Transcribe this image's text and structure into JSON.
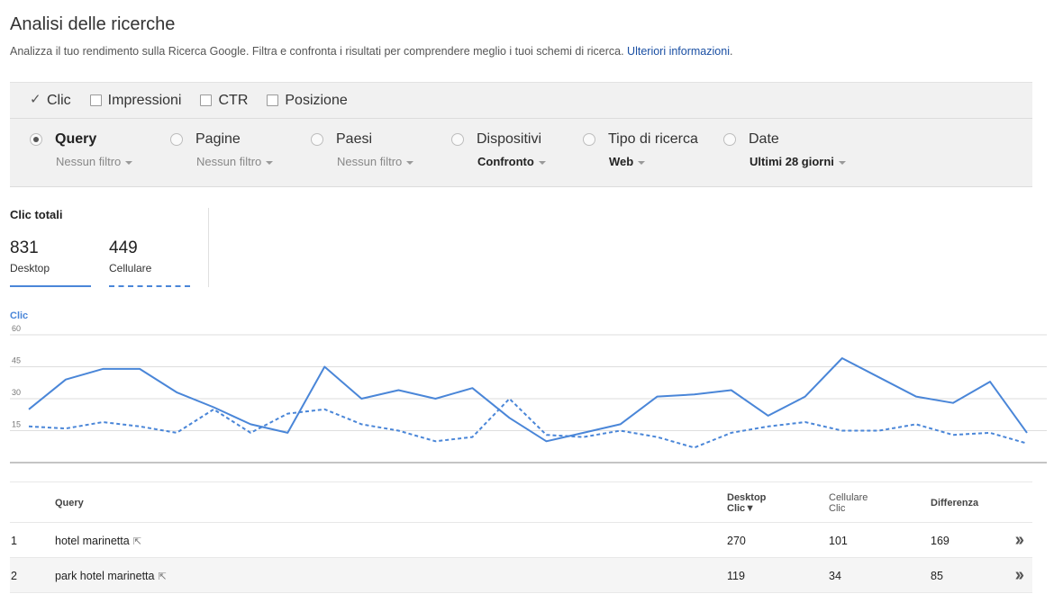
{
  "header": {
    "title": "Analisi delle ricerche",
    "description": "Analizza il tuo rendimento sulla Ricerca Google. Filtra e confronta i risultati per comprendere meglio i tuoi schemi di ricerca.",
    "link": "Ulteriori informazioni",
    "link_suffix": "."
  },
  "metrics": [
    {
      "label": "Clic",
      "checked": true
    },
    {
      "label": "Impressioni",
      "checked": false
    },
    {
      "label": "CTR",
      "checked": false
    },
    {
      "label": "Posizione",
      "checked": false
    }
  ],
  "dimensions": [
    {
      "label": "Query",
      "filter": "Nessun filtro",
      "selected": true
    },
    {
      "label": "Pagine",
      "filter": "Nessun filtro",
      "selected": false
    },
    {
      "label": "Paesi",
      "filter": "Nessun filtro",
      "selected": false
    },
    {
      "label": "Dispositivi",
      "filter": "Confronto",
      "selected": false
    },
    {
      "label": "Tipo di ricerca",
      "filter": "Web",
      "selected": false
    },
    {
      "label": "Date",
      "filter": "Ultimi 28 giorni",
      "selected": false
    }
  ],
  "totals": {
    "title": "Clic totali",
    "items": [
      {
        "value": "831",
        "label": "Desktop"
      },
      {
        "value": "449",
        "label": "Cellulare"
      }
    ]
  },
  "colors": {
    "series": "#4a86d8",
    "link": "#1a4fa3"
  },
  "chart_data": {
    "type": "line",
    "ylabel": "Clic",
    "ylim": [
      0,
      60
    ],
    "yticks": [
      15,
      30,
      45,
      60
    ],
    "grid": true,
    "series": [
      {
        "name": "Desktop",
        "style": "solid",
        "values": [
          25,
          39,
          44,
          44,
          33,
          26,
          18,
          14,
          45,
          30,
          34,
          30,
          35,
          21,
          10,
          14,
          18,
          31,
          32,
          34,
          22,
          31,
          49,
          40,
          31,
          28,
          38,
          14
        ]
      },
      {
        "name": "Cellulare",
        "style": "dashed",
        "values": [
          17,
          16,
          19,
          17,
          14,
          25,
          14,
          23,
          25,
          18,
          15,
          10,
          12,
          30,
          13,
          12,
          15,
          12,
          7,
          14,
          17,
          19,
          15,
          15,
          18,
          13,
          14,
          9
        ]
      }
    ]
  },
  "table": {
    "headers": {
      "query": "Query",
      "desktop_line1": "Desktop",
      "desktop_line2": "Clic▼",
      "mobile_line1": "Cellulare",
      "mobile_line2": "Clic",
      "diff": "Differenza"
    },
    "rows": [
      {
        "rank": "1",
        "query": "hotel marinetta",
        "desktop": "270",
        "mobile": "101",
        "diff": "169"
      },
      {
        "rank": "2",
        "query": "park hotel marinetta",
        "desktop": "119",
        "mobile": "34",
        "diff": "85"
      }
    ]
  }
}
